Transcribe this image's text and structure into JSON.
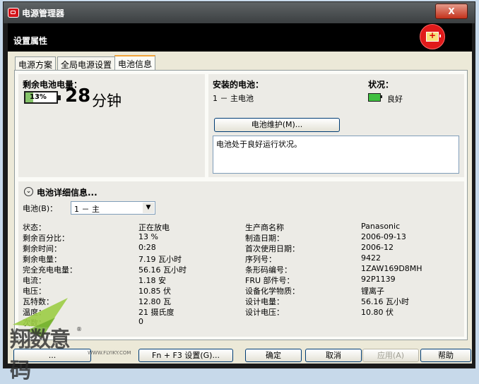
{
  "window": {
    "title": "电源管理器",
    "close_label": "X"
  },
  "header": {
    "title": "设置属性",
    "icon": "battery-plus-icon"
  },
  "tabs": [
    {
      "label": "电源方案"
    },
    {
      "label": "全局电源设置"
    },
    {
      "label": "电池信息"
    }
  ],
  "summary": {
    "remaining_label": "剩余电池电量：",
    "percent_text": "13%",
    "percent_value": 13,
    "minutes": "28",
    "minutes_unit": "分钟"
  },
  "installed": {
    "label": "安装的电池：",
    "battery_entry": "1 － 主电池",
    "status_label": "状况：",
    "status_value": "良好",
    "maintenance_button": "电池维护(M)...",
    "message": "电池处于良好运行状况。"
  },
  "details": {
    "title": "电池详细信息...",
    "battery_select_label": "电池(B)：",
    "battery_select_value": "1 － 主",
    "left_rows": [
      {
        "label": "状态：",
        "value": "正在放电"
      },
      {
        "label": "剩余百分比：",
        "value": "13 %"
      },
      {
        "label": "剩余时间：",
        "value": "0:28"
      },
      {
        "label": "剩余电量：",
        "value": "7.19 瓦小时"
      },
      {
        "label": "完全充电电量：",
        "value": "56.16 瓦小时"
      },
      {
        "label": "电流：",
        "value": "1.18 安"
      },
      {
        "label": "电压：",
        "value": "10.85 伏"
      },
      {
        "label": "瓦特数：",
        "value": "12.80 瓦"
      },
      {
        "label": "温度：",
        "value": "21 摄氏度"
      },
      {
        "label": "次数：",
        "value": "0"
      }
    ],
    "right_rows": [
      {
        "label": "生产商名称",
        "value": "Panasonic"
      },
      {
        "label": "制造日期：",
        "value": "2006-09-13"
      },
      {
        "label": "首次使用日期：",
        "value": "2006-12"
      },
      {
        "label": "序列号：",
        "value": "9422"
      },
      {
        "label": "条形码编号：",
        "value": "1ZAW169D8MH"
      },
      {
        "label": "FRU 部件号：",
        "value": "92P1139"
      },
      {
        "label": "设备化学物质：",
        "value": "锂离子"
      },
      {
        "label": "设计电量：",
        "value": "56.16 瓦小时"
      },
      {
        "label": "设计电压：",
        "value": "10.80 伏"
      }
    ]
  },
  "footer": {
    "left_button": "...",
    "fn_f3_button": "Fn + F3 设置(G)...",
    "ok_button": "确定",
    "cancel_button": "取消",
    "apply_button": "应用(A)",
    "help_button": "帮助"
  },
  "watermark": {
    "brand": "翔数意码",
    "url": "WWW.FLYIKY.COM"
  }
}
